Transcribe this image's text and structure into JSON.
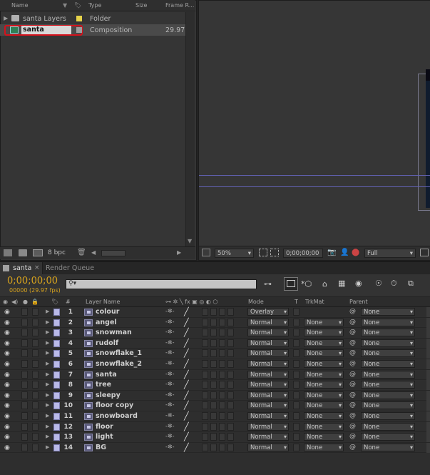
{
  "project": {
    "columns": {
      "name": "Name",
      "type": "Type",
      "size": "Size",
      "frame_rate": "Frame R..."
    },
    "items": [
      {
        "name": "santa Layers",
        "type": "Folder",
        "size": "",
        "frame_rate": "",
        "label_color": "#e6d24a",
        "icon": "folder-icon"
      },
      {
        "name": "santa",
        "type": "Composition",
        "size": "",
        "frame_rate": "29.97",
        "label_color": "#9e9e9e",
        "icon": "composition-icon",
        "selected": true
      }
    ],
    "footer": {
      "bit_depth": "8 bpc"
    }
  },
  "viewer": {
    "zoom": "50%",
    "timecode": "0;00;00;00",
    "resolution": "Full"
  },
  "timeline": {
    "tabs": [
      {
        "label": "santa",
        "active": true
      },
      {
        "label": "Render Queue",
        "active": false
      }
    ],
    "current_time": "0;00;00;00",
    "frame_info": "00000 (29.97 fps)",
    "search_placeholder": "",
    "columns": {
      "num": "#",
      "layer_name": "Layer Name",
      "mode": "Mode",
      "t": "T",
      "trkmat": "TrkMat",
      "parent": "Parent"
    },
    "layers": [
      {
        "num": "1",
        "name": "colour",
        "mode": "Overlay",
        "trkmat": "",
        "parent": "None"
      },
      {
        "num": "2",
        "name": "angel",
        "mode": "Normal",
        "trkmat": "None",
        "parent": "None"
      },
      {
        "num": "3",
        "name": "snowman",
        "mode": "Normal",
        "trkmat": "None",
        "parent": "None"
      },
      {
        "num": "4",
        "name": "rudolf",
        "mode": "Normal",
        "trkmat": "None",
        "parent": "None"
      },
      {
        "num": "5",
        "name": "snowflake_1",
        "mode": "Normal",
        "trkmat": "None",
        "parent": "None"
      },
      {
        "num": "6",
        "name": "snowflake_2",
        "mode": "Normal",
        "trkmat": "None",
        "parent": "None"
      },
      {
        "num": "7",
        "name": "santa",
        "mode": "Normal",
        "trkmat": "None",
        "parent": "None"
      },
      {
        "num": "8",
        "name": "tree",
        "mode": "Normal",
        "trkmat": "None",
        "parent": "None"
      },
      {
        "num": "9",
        "name": "sleepy",
        "mode": "Normal",
        "trkmat": "None",
        "parent": "None"
      },
      {
        "num": "10",
        "name": "floor copy",
        "mode": "Normal",
        "trkmat": "None",
        "parent": "None"
      },
      {
        "num": "11",
        "name": "snowboard",
        "mode": "Normal",
        "trkmat": "None",
        "parent": "None"
      },
      {
        "num": "12",
        "name": "floor",
        "mode": "Normal",
        "trkmat": "None",
        "parent": "None"
      },
      {
        "num": "13",
        "name": "light",
        "mode": "Normal",
        "trkmat": "None",
        "parent": "None"
      },
      {
        "num": "14",
        "name": "BG",
        "mode": "Normal",
        "trkmat": "None",
        "parent": "None"
      }
    ]
  },
  "colors": {
    "highlight": "#d4121c",
    "timecode": "#d6a21e",
    "label_swatch": "#b9b9e8"
  }
}
